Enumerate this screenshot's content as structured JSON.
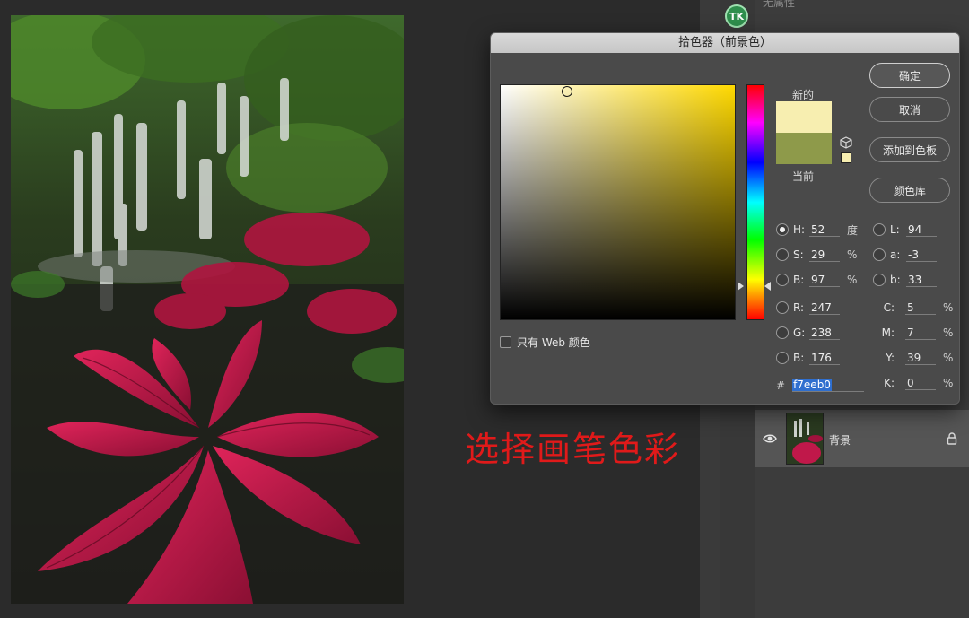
{
  "right_panel": {
    "top_text": "无属性",
    "tool_icon_text": "TK",
    "layer": {
      "name": "背景"
    }
  },
  "annotation": "选择画笔色彩",
  "picker": {
    "title": "拾色器（前景色）",
    "new_label": "新的",
    "current_label": "当前",
    "new_color": "#f7eeb0",
    "current_color": "#8e9a4a",
    "buttons": {
      "ok": "确定",
      "cancel": "取消",
      "add_to_swatches": "添加到色板",
      "color_libraries": "颜色库"
    },
    "web_only_label": "只有 Web 颜色",
    "hsb": [
      {
        "label": "H:",
        "value": "52",
        "unit": "度",
        "selected": true
      },
      {
        "label": "S:",
        "value": "29",
        "unit": "%",
        "selected": false
      },
      {
        "label": "B:",
        "value": "97",
        "unit": "%",
        "selected": false
      }
    ],
    "rgb": [
      {
        "label": "R:",
        "value": "247"
      },
      {
        "label": "G:",
        "value": "238"
      },
      {
        "label": "B:",
        "value": "176"
      }
    ],
    "lab": [
      {
        "label": "L:",
        "value": "94"
      },
      {
        "label": "a:",
        "value": "-3"
      },
      {
        "label": "b:",
        "value": "33"
      }
    ],
    "cmyk": [
      {
        "label": "C:",
        "value": "5",
        "unit": "%"
      },
      {
        "label": "M:",
        "value": "7",
        "unit": "%"
      },
      {
        "label": "Y:",
        "value": "39",
        "unit": "%"
      },
      {
        "label": "K:",
        "value": "0",
        "unit": "%"
      }
    ],
    "hex_prefix": "#",
    "hex_value": "f7eeb0"
  }
}
